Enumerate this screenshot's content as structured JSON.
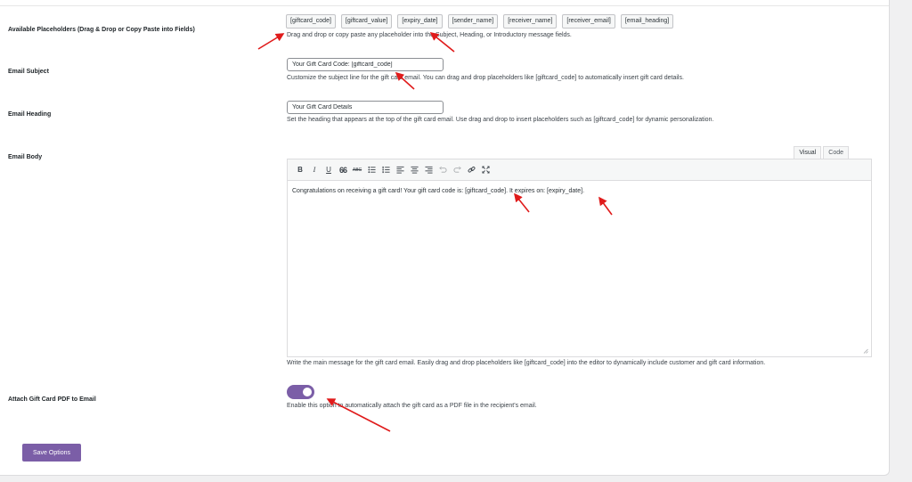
{
  "placeholders": {
    "label": "Available Placeholders (Drag & Drop or Copy Paste into Fields)",
    "chips": [
      "[giftcard_code]",
      "[giftcard_value]",
      "[expiry_date]",
      "[sender_name]",
      "[receiver_name]",
      "[receiver_email]",
      "[email_heading]"
    ],
    "description": "Drag and drop or copy paste any placeholder into the Subject, Heading, or Introductory message fields."
  },
  "subject": {
    "label": "Email Subject",
    "value": "Your Gift Card Code: [giftcard_code]",
    "description": "Customize the subject line for the gift card email. You can drag and drop placeholders like [giftcard_code] to automatically insert gift card details."
  },
  "heading": {
    "label": "Email Heading",
    "value": "Your Gift Card Details",
    "description": "Set the heading that appears at the top of the gift card email. Use drag and drop to insert placeholders such as [giftcard_code] for dynamic personalization."
  },
  "body": {
    "label": "Email Body",
    "tabs": {
      "visual": "Visual",
      "code": "Code"
    },
    "toolbar": {
      "bold": "B",
      "italic": "I",
      "underline": "U",
      "quote": "66",
      "strike": "ABC"
    },
    "content": "Congratulations on receiving a gift card! Your gift card code is: [giftcard_code]. It expires on: [expiry_date].",
    "description": "Write the main message for the gift card email. Easily drag and drop placeholders like [giftcard_code] into the editor to dynamically include customer and gift card information."
  },
  "attach_pdf": {
    "label": "Attach Gift Card PDF to Email",
    "enabled": true,
    "description": "Enable this option to automatically attach the gift card as a PDF file in the recipient's email."
  },
  "save_button": "Save Options",
  "colors": {
    "accent": "#7b5ea7",
    "arrow": "#e01b1b"
  }
}
